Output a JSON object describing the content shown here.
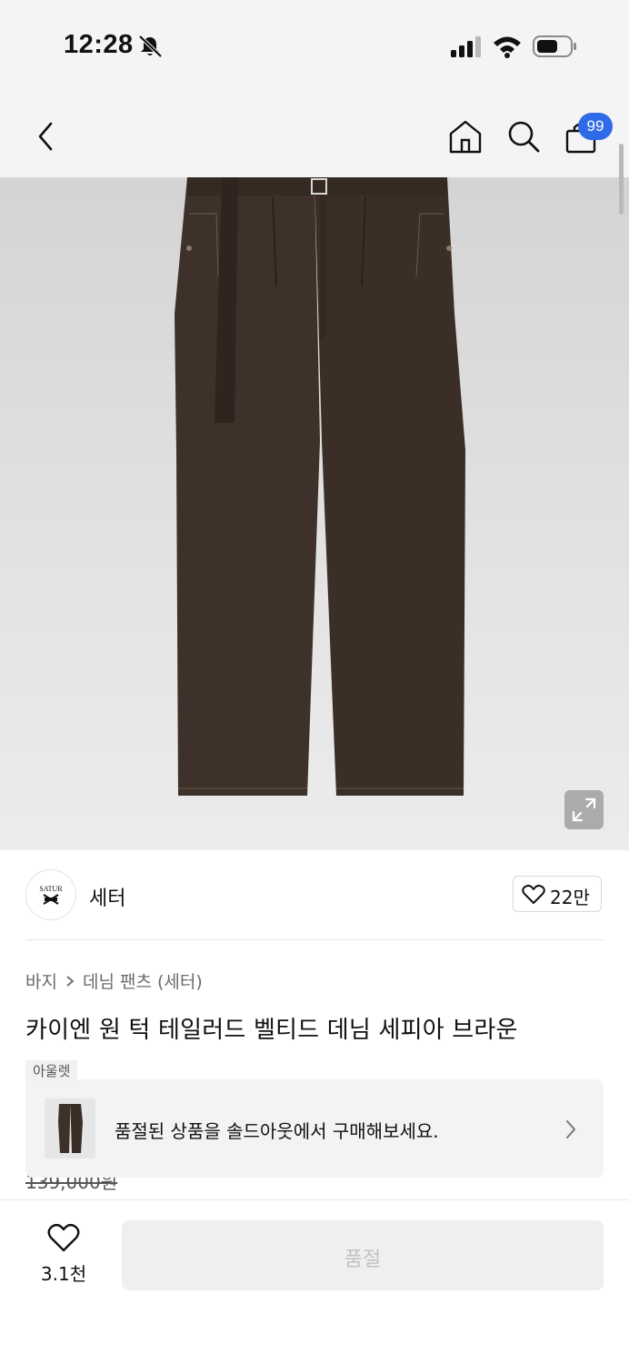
{
  "status": {
    "time": "12:28"
  },
  "header": {
    "cart_badge": "99"
  },
  "brand": {
    "name": "세터",
    "logo_text": "SATUR",
    "like_count": "22만"
  },
  "breadcrumb": {
    "level1": "바지",
    "level2": "데님 팬츠 (세터)"
  },
  "product": {
    "title": "카이엔 원 턱 테일러드 벨티드 데님 세피아 브라운",
    "tag": "아울렛",
    "original_price": "139,000원"
  },
  "soldout_banner": {
    "text": "품절된 상품을 솔드아웃에서 구매해보세요."
  },
  "bottom": {
    "like_count": "3.1천",
    "buy_label": "품절"
  },
  "colors": {
    "accent_badge": "#2f6be8",
    "product_brown": "#3b2f27"
  },
  "icons": [
    "bell-slash-icon",
    "signal-icon",
    "wifi-icon",
    "battery-icon",
    "back-chevron-icon",
    "home-icon",
    "search-icon",
    "cart-icon",
    "expand-icon",
    "heart-icon",
    "chevron-right-icon"
  ]
}
